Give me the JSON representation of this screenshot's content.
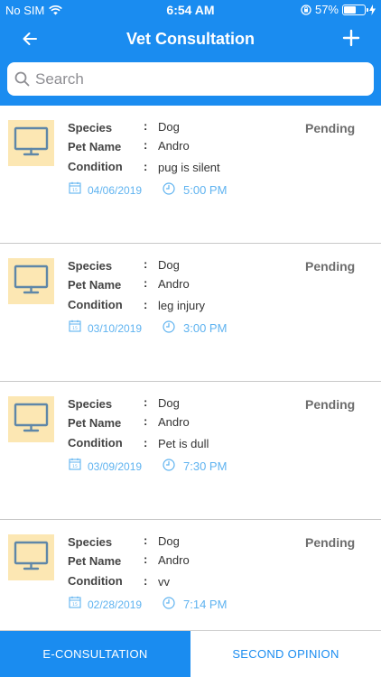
{
  "status_bar": {
    "carrier": "No SIM",
    "time": "6:54 AM",
    "battery": "57%",
    "battery_level": 0.57
  },
  "nav": {
    "title": "Vet Consultation",
    "back_icon": "arrow-left-icon",
    "add_icon": "plus-icon"
  },
  "search": {
    "placeholder": "Search"
  },
  "labels": {
    "species": "Species",
    "pet_name": "Pet Name",
    "condition": "Condition",
    "colon": ":"
  },
  "consultations": [
    {
      "species": "Dog",
      "pet_name": "Andro",
      "condition": "pug is silent",
      "date": "04/06/2019",
      "time": "5:00 PM",
      "status": "Pending"
    },
    {
      "species": "Dog",
      "pet_name": "Andro",
      "condition": "leg injury",
      "date": "03/10/2019",
      "time": "3:00 PM",
      "status": "Pending"
    },
    {
      "species": "Dog",
      "pet_name": "Andro",
      "condition": "Pet is dull",
      "date": "03/09/2019",
      "time": "7:30 PM",
      "status": "Pending"
    },
    {
      "species": "Dog",
      "pet_name": "Andro",
      "condition": "vv",
      "date": "02/28/2019",
      "time": "7:14 PM",
      "status": "Pending"
    }
  ],
  "tabs": [
    {
      "label": "E-CONSULTATION",
      "active": true
    },
    {
      "label": "SECOND OPINION",
      "active": false
    }
  ],
  "colors": {
    "primary": "#1a8cf0",
    "thumb_bg": "#fce7b3",
    "thumb_icon": "#5f87a8",
    "date_time": "#5fb3f0",
    "status_text": "#6d6d6d"
  }
}
